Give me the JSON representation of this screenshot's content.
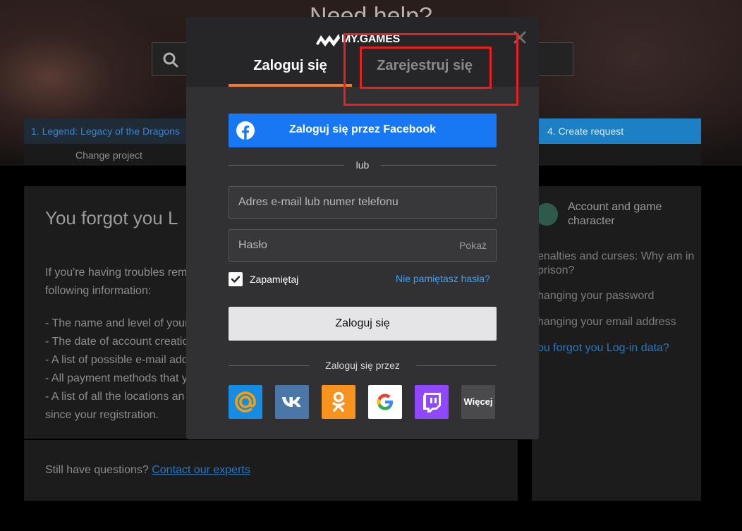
{
  "background_page": {
    "help_title": "Need help?",
    "breadcrumb_step1": "1. Legend: Legacy of the Dragons",
    "breadcrumb_step4": "4. Create request",
    "change_project": "Change project",
    "article_title": "You forgot you L",
    "article_lines": [
      "If you're having troubles rem",
      "following information:",
      "- The name and level of your",
      "- The date of account creatio",
      "- A list of possible e-mail add",
      "- All payment methods that y",
      "- A list of all the locations an",
      "since your registration."
    ],
    "footer_text": "Still have questions?",
    "footer_link": "Contact our experts",
    "sidebar": {
      "title": "Account and game character",
      "links": [
        "enalties and curses: Why am in prison?",
        "hanging your password",
        "hanging your email address",
        "ou forgot you Log-in data?"
      ]
    }
  },
  "modal": {
    "brand": "MY.GAMES",
    "tabs": [
      {
        "label": "Zaloguj się",
        "active": true
      },
      {
        "label": "Zarejestruj się",
        "active": false
      }
    ],
    "facebook_button": "Zaloguj się przez Facebook",
    "divider_or": "lub",
    "email_placeholder": "Adres e-mail lub numer telefonu",
    "password_placeholder": "Hasło",
    "show_password": "Pokaż",
    "remember_label": "Zapamiętaj",
    "remember_checked": true,
    "forgot_link": "Nie pamiętasz hasła?",
    "submit_button": "Zaloguj się",
    "social_divider": "Zaloguj się przez",
    "social_providers": [
      "mail-ru",
      "vk",
      "odnoklassniki",
      "google",
      "twitch"
    ],
    "more_button": "Więcej"
  },
  "colors": {
    "accent_orange": "#f37c2c",
    "facebook_blue": "#1877f2",
    "link_blue": "#33a3ff",
    "highlight_red": "#e82020"
  }
}
